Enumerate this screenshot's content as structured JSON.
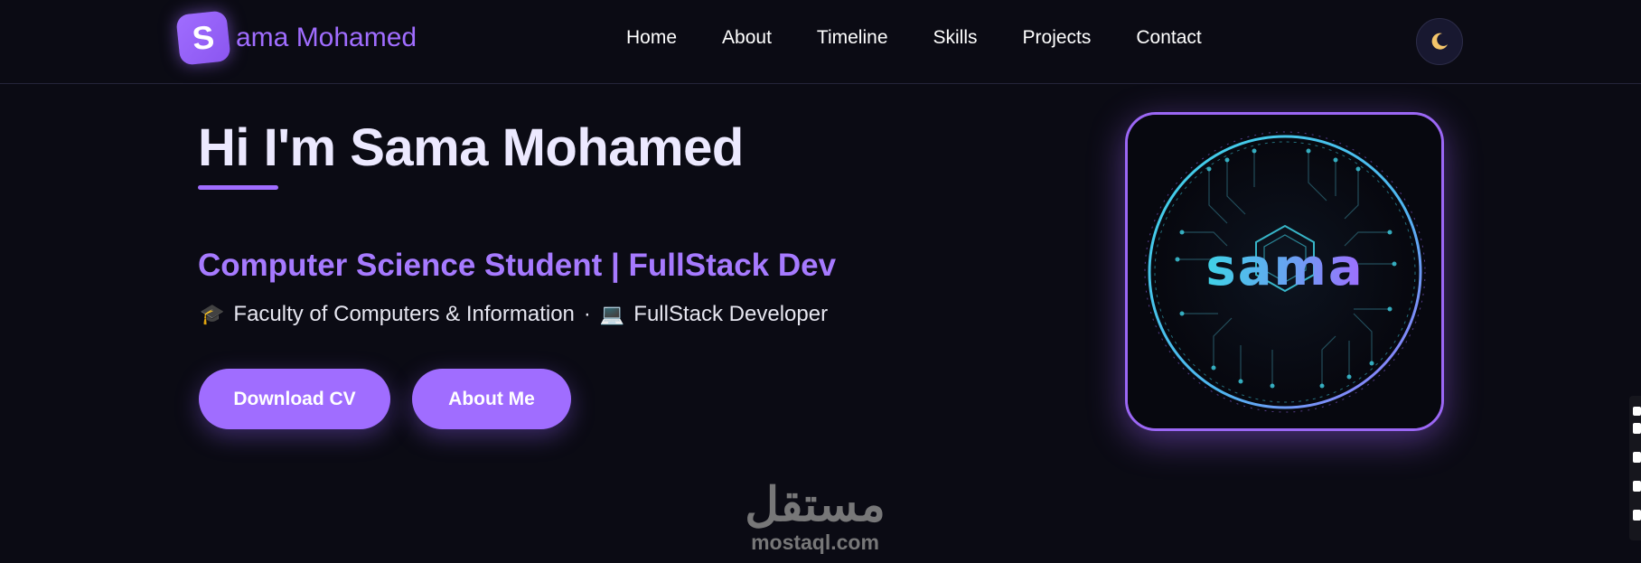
{
  "nav": {
    "logo_letter": "S",
    "logo_text": "ama Mohamed",
    "links": [
      "Home",
      "About",
      "Timeline",
      "Skills",
      "Projects",
      "Contact"
    ],
    "theme_icon": "moon-icon"
  },
  "hero": {
    "title": "Hi I'm Sama Mohamed",
    "subtitle": "Computer Science Student | FullStack Dev",
    "info_faculty": "Faculty of Computers & Information",
    "info_separator": "·",
    "info_role": "FullStack Developer",
    "faculty_icon": "graduation-cap-icon",
    "role_icon": "laptop-icon",
    "buttons": {
      "download_cv": "Download CV",
      "about_me": "About Me"
    }
  },
  "profile_image": {
    "logo_text": "sama"
  },
  "watermark": {
    "arabic": "مستقل",
    "latin": "mostaql.com"
  },
  "colors": {
    "background": "#0b0b14",
    "accent": "#a06dff",
    "cyan": "#3fd2e6"
  }
}
